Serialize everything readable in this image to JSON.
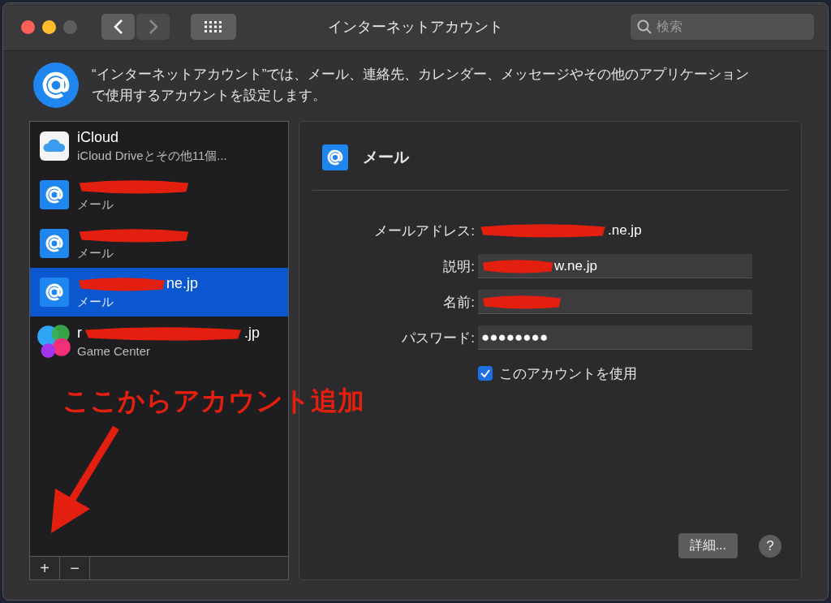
{
  "window": {
    "title": "インターネットアカウント",
    "search": {
      "placeholder": "検索"
    }
  },
  "intro": "“インターネットアカウント”では、メール、連絡先、カレンダー、メッセージやその他のアプリケーションで使用するアカウントを設定します。",
  "accounts": [
    {
      "kind": "icloud",
      "name_prefix": "iCloud",
      "subtitle": "iCloud Driveとその他11個...",
      "selected": false
    },
    {
      "kind": "mail",
      "redacted": true,
      "subtitle": "メール",
      "selected": false
    },
    {
      "kind": "mail",
      "redacted": true,
      "subtitle": "メール",
      "selected": false
    },
    {
      "kind": "mail",
      "name_suffix": "ne.jp",
      "redacted": true,
      "subtitle": "メール",
      "selected": true
    },
    {
      "kind": "gamecenter",
      "name_prefix": "r",
      "name_suffix": ".jp",
      "redacted": true,
      "subtitle": "Game Center",
      "selected": false
    }
  ],
  "list_buttons": [
    "+",
    "−"
  ],
  "annotation": "ここからアカウント追加",
  "detail": {
    "title": "メール",
    "fields": [
      {
        "kind": "text",
        "label": "メールアドレス:",
        "value": ".ne.jp",
        "redacted": true
      },
      {
        "kind": "input",
        "label": "説明:",
        "value": "w.ne.jp",
        "redacted": true
      },
      {
        "kind": "input",
        "label": "名前:",
        "redacted": true
      },
      {
        "kind": "input",
        "label": "パスワード:",
        "value": "●●●●●●●●"
      }
    ],
    "use_account": {
      "label": "このアカウントを使用",
      "checked": true
    },
    "details_button": "詳細...",
    "help_button": "?"
  }
}
